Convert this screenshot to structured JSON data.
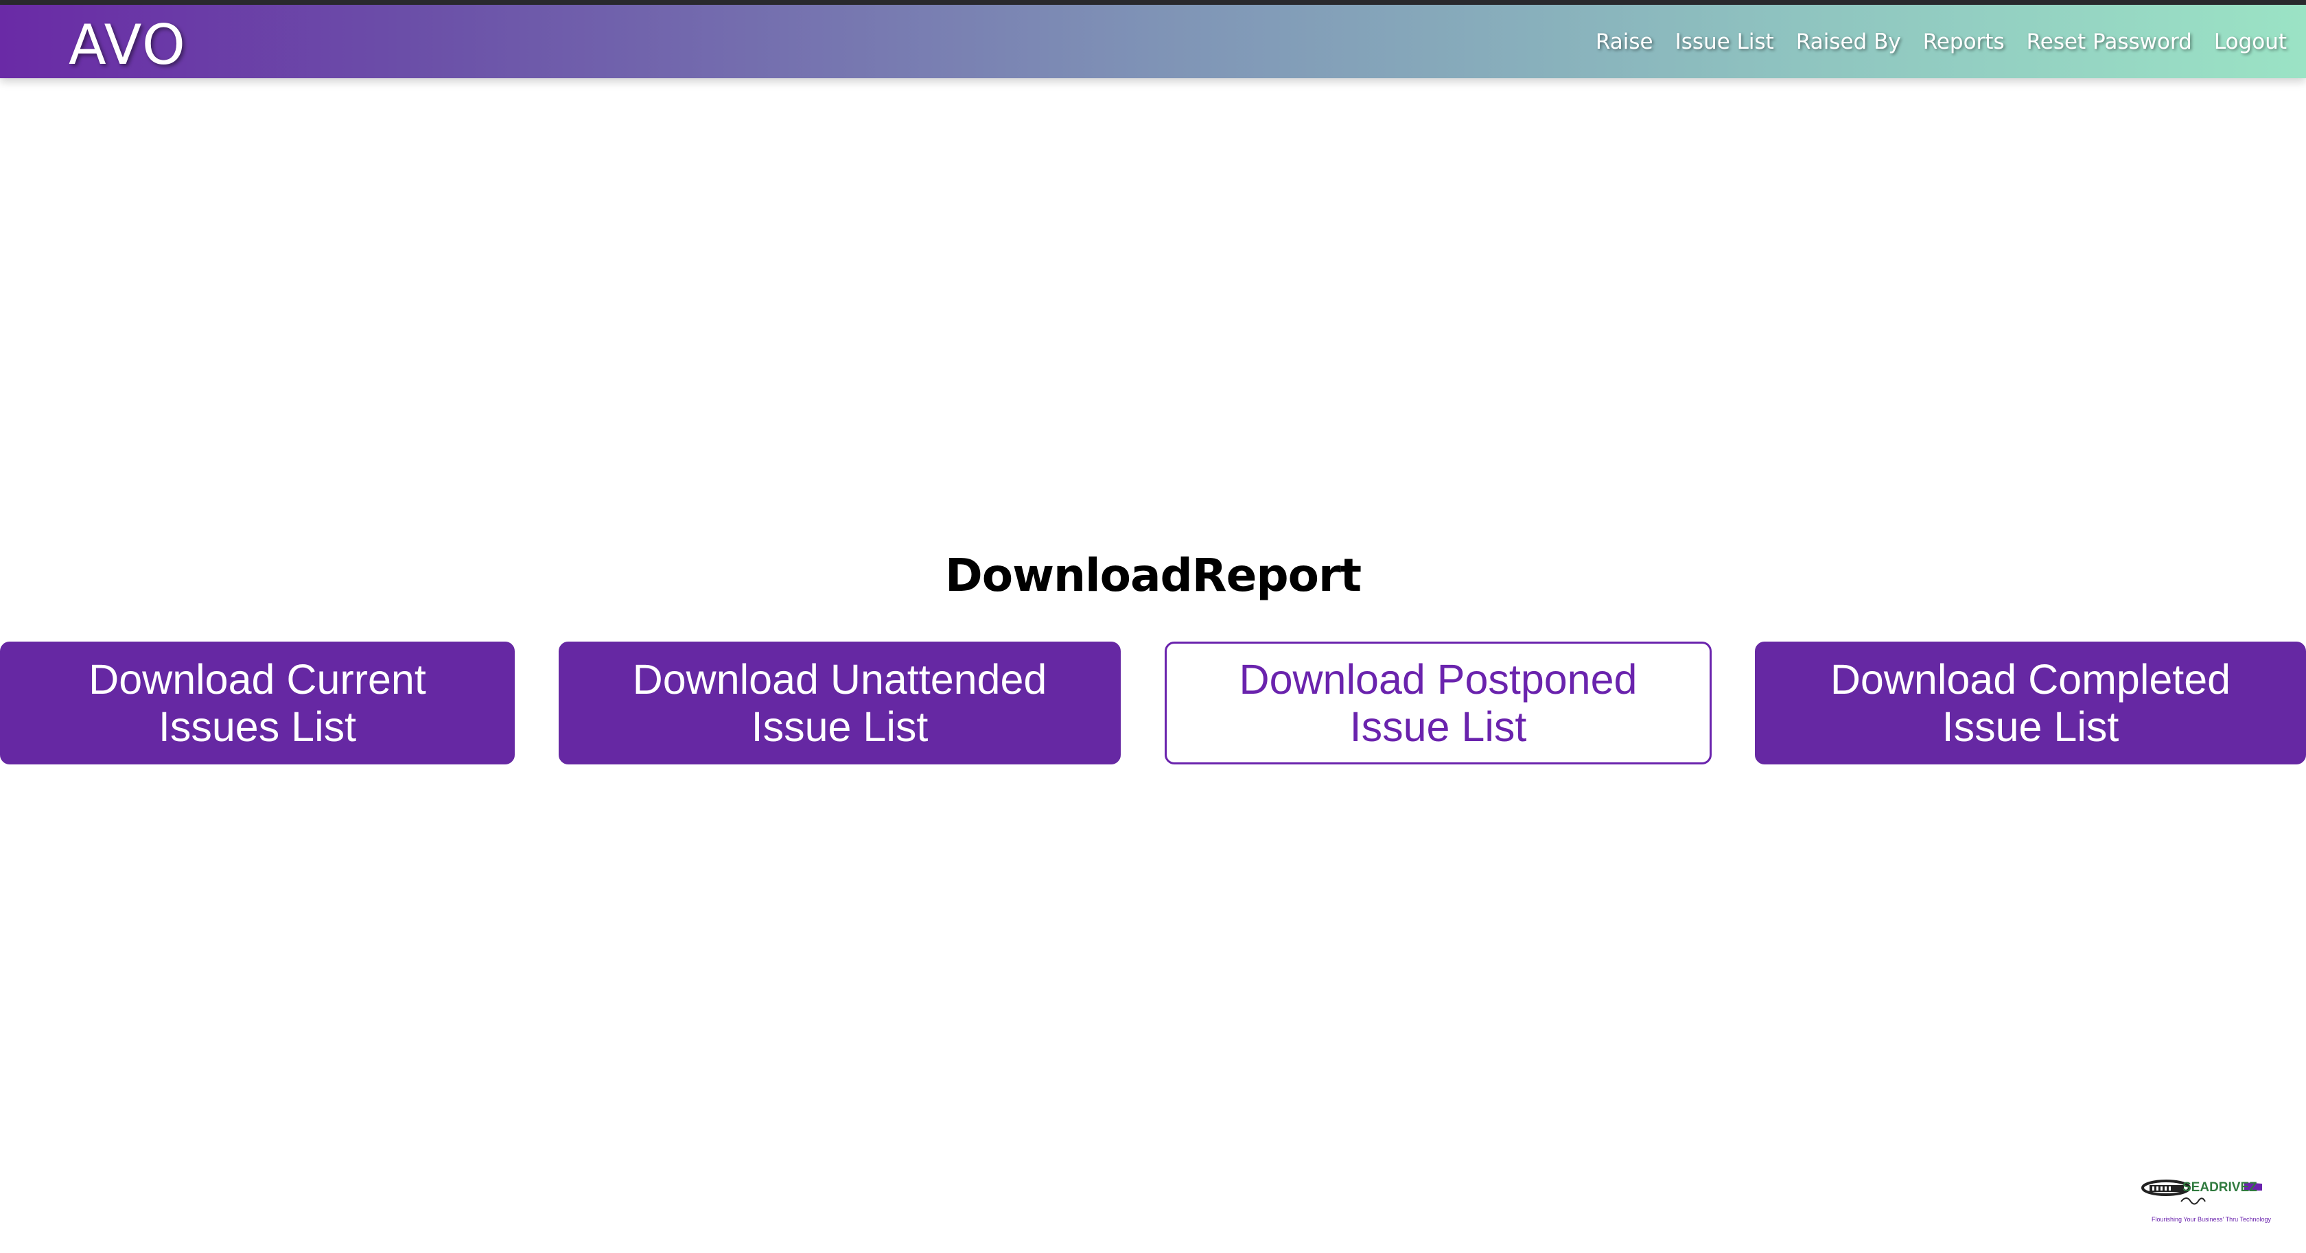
{
  "app": {
    "brand": "AVO"
  },
  "nav": {
    "items": [
      {
        "label": "Raise"
      },
      {
        "label": "Issue List"
      },
      {
        "label": "Raised By"
      },
      {
        "label": "Reports"
      },
      {
        "label": "Reset Password"
      },
      {
        "label": "Logout"
      }
    ]
  },
  "main": {
    "title": "DownloadReport",
    "buttons": [
      {
        "line1": "Download Current",
        "line2": "Issues List",
        "style": "filled"
      },
      {
        "line1": "Download Unattended",
        "line2": "Issue List",
        "style": "filled"
      },
      {
        "line1": "Download Postponed",
        "line2": "Issue List",
        "style": "outline"
      },
      {
        "line1": "Download Completed",
        "line2": "Issue List",
        "style": "filled"
      }
    ]
  },
  "footer": {
    "logo_text": "SEADRIVEZ",
    "logo_tagline": "Flourishing Your Business' Thru Technology"
  },
  "colors": {
    "accent": "#6628a3",
    "gradient_start": "#6a2aa6",
    "gradient_end": "#9be3c5"
  }
}
